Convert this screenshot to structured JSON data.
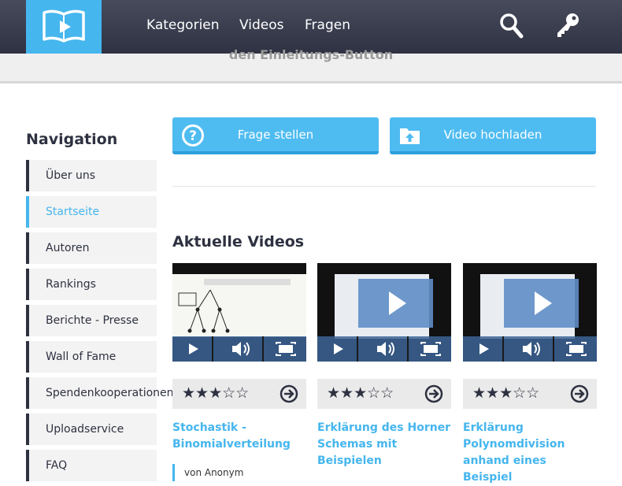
{
  "header": {
    "nav": [
      "Kategorien",
      "Videos",
      "Fragen"
    ],
    "subband_text": "den Einleitungs-Button"
  },
  "sidebar": {
    "title": "Navigation",
    "items": [
      {
        "label": "Über uns"
      },
      {
        "label": "Startseite"
      },
      {
        "label": "Autoren"
      },
      {
        "label": "Rankings"
      },
      {
        "label": "Berichte - Presse"
      },
      {
        "label": "Wall of Fame"
      },
      {
        "label": "Spendenkooperationen"
      },
      {
        "label": "Uploadservice"
      },
      {
        "label": "FAQ"
      }
    ],
    "active_index": 1
  },
  "actions": {
    "ask_label": "Frage stellen",
    "upload_label": "Video hochladen"
  },
  "videos": {
    "title": "Aktuelle Videos",
    "items": [
      {
        "title": "Stochastik - Binomialverteilung",
        "rating": 3,
        "max_rating": 5,
        "author": "von Anonym"
      },
      {
        "title": "Erklärung des Horner Schemas mit Beispielen",
        "rating": 3,
        "max_rating": 5
      },
      {
        "title": "Erklärung Polynomdivision anhand eines Beispiel",
        "rating": 3,
        "max_rating": 5
      }
    ]
  },
  "colors": {
    "accent": "#45b6ee",
    "dark": "#2e3140"
  }
}
